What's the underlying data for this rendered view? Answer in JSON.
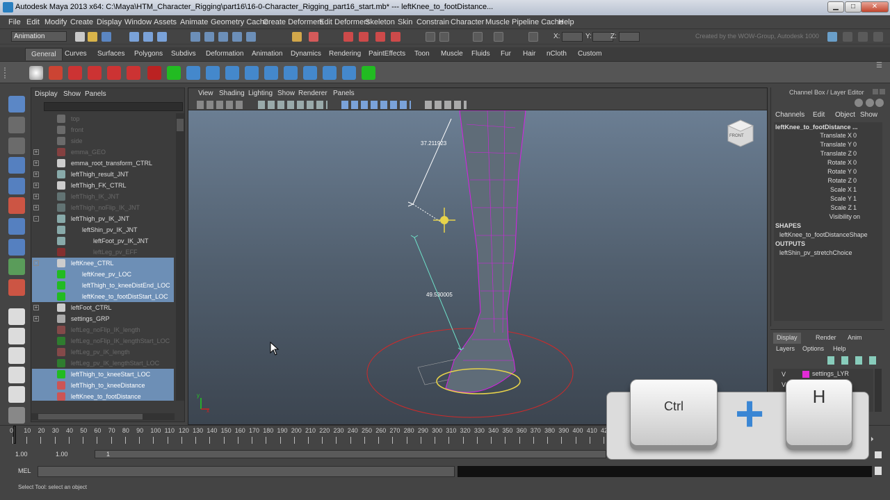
{
  "window": {
    "title": "Autodesk Maya 2013 x64: C:\\Maya\\HTM_Character_Rigging\\part16\\16-0-Character_Rigging_part16_start.mb*   ---   leftKnee_to_footDistance...",
    "min_label": "▁",
    "max_label": "□",
    "close_label": "✕"
  },
  "menubar": [
    "File",
    "Edit",
    "Modify",
    "Create",
    "Display",
    "Window",
    "Assets",
    "Animate",
    "Geometry Cache",
    "Create Deformers",
    "Edit Deformers",
    "Skeleton",
    "Skin",
    "Constrain",
    "Character",
    "Muscle",
    "Pipeline Cache",
    "Help"
  ],
  "status_line": {
    "mode": "Animation",
    "x_label": "X:",
    "y_label": "Y:",
    "z_label": "Z:",
    "credit": "Created by the WOW-Group, Autodesk 1000"
  },
  "shelf_tabs": [
    "General",
    "Curves",
    "Surfaces",
    "Polygons",
    "Subdivs",
    "Deformation",
    "Animation",
    "Dynamics",
    "Rendering",
    "PaintEffects",
    "Toon",
    "Muscle",
    "Fluids",
    "Fur",
    "Hair",
    "nCloth",
    "Custom"
  ],
  "shelf_active": "General",
  "outliner": {
    "menus": [
      "Display",
      "Show",
      "Panels"
    ],
    "rows": [
      {
        "label": "top",
        "icon": "camera-icon",
        "dim": true,
        "sel": false,
        "indent": 0,
        "expand": ""
      },
      {
        "label": "front",
        "icon": "camera-icon",
        "dim": true,
        "sel": false,
        "indent": 0,
        "expand": ""
      },
      {
        "label": "side",
        "icon": "camera-icon",
        "dim": true,
        "sel": false,
        "indent": 0,
        "expand": ""
      },
      {
        "label": "emma_GEO",
        "icon": "mesh-icon",
        "dim": true,
        "sel": false,
        "indent": 0,
        "expand": "+"
      },
      {
        "label": "emma_root_transform_CTRL",
        "icon": "curve-icon",
        "dim": false,
        "sel": false,
        "indent": 0,
        "expand": "+"
      },
      {
        "label": "leftThigh_result_JNT",
        "icon": "joint-icon",
        "dim": false,
        "sel": false,
        "indent": 0,
        "expand": "+"
      },
      {
        "label": "leftThigh_FK_CTRL",
        "icon": "curve-icon",
        "dim": false,
        "sel": false,
        "indent": 0,
        "expand": "+"
      },
      {
        "label": "leftThigh_IK_JNT",
        "icon": "joint-icon",
        "dim": true,
        "sel": false,
        "indent": 0,
        "expand": "+"
      },
      {
        "label": "leftThigh_noFlip_IK_JNT",
        "icon": "joint-icon",
        "dim": true,
        "sel": false,
        "indent": 0,
        "expand": "+"
      },
      {
        "label": "leftThigh_pv_IK_JNT",
        "icon": "joint-icon",
        "dim": false,
        "sel": false,
        "indent": 0,
        "expand": "-"
      },
      {
        "label": "leftShin_pv_IK_JNT",
        "icon": "joint-icon",
        "dim": false,
        "sel": false,
        "indent": 1,
        "expand": ""
      },
      {
        "label": "leftFoot_pv_IK_JNT",
        "icon": "joint-icon",
        "dim": false,
        "sel": false,
        "indent": 2,
        "expand": ""
      },
      {
        "label": "leftLeg_pv_EFF",
        "icon": "effector-icon",
        "dim": true,
        "sel": false,
        "indent": 2,
        "expand": ""
      },
      {
        "label": "leftKnee_CTRL",
        "icon": "curve-icon",
        "dim": false,
        "sel": true,
        "indent": 0,
        "expand": "-"
      },
      {
        "label": "leftKnee_pv_LOC",
        "icon": "locator-icon",
        "dim": false,
        "sel": true,
        "indent": 1,
        "expand": ""
      },
      {
        "label": "leftThigh_to_kneeDistEnd_LOC",
        "icon": "locator-icon",
        "dim": false,
        "sel": true,
        "indent": 1,
        "expand": ""
      },
      {
        "label": "leftKnee_to_footDistStart_LOC",
        "icon": "locator-icon",
        "dim": false,
        "sel": true,
        "indent": 1,
        "expand": ""
      },
      {
        "label": "leftFoot_CTRL",
        "icon": "curve-icon",
        "dim": false,
        "sel": false,
        "indent": 0,
        "expand": "+"
      },
      {
        "label": "settings_GRP",
        "icon": "group-icon",
        "dim": false,
        "sel": false,
        "indent": 0,
        "expand": "+"
      },
      {
        "label": "leftLeg_noFlip_IK_length",
        "icon": "distance-icon",
        "dim": true,
        "sel": false,
        "indent": 0,
        "expand": ""
      },
      {
        "label": "leftLeg_noFlip_IK_lengthStart_LOC",
        "icon": "locator-icon",
        "dim": true,
        "sel": false,
        "indent": 0,
        "expand": ""
      },
      {
        "label": "leftLeg_pv_IK_length",
        "icon": "distance-icon",
        "dim": true,
        "sel": false,
        "indent": 0,
        "expand": ""
      },
      {
        "label": "leftLeg_pv_IK_lengthStart_LOC",
        "icon": "locator-icon",
        "dim": true,
        "sel": false,
        "indent": 0,
        "expand": ""
      },
      {
        "label": "leftThigh_to_kneeStart_LOC",
        "icon": "locator-icon",
        "dim": false,
        "sel": true,
        "indent": 0,
        "expand": ""
      },
      {
        "label": "leftThigh_to_kneeDistance",
        "icon": "distance-icon",
        "dim": false,
        "sel": true,
        "indent": 0,
        "expand": ""
      },
      {
        "label": "leftKnee_to_footDistance",
        "icon": "distance-icon",
        "dim": false,
        "sel": true,
        "indent": 0,
        "expand": ""
      }
    ]
  },
  "viewport": {
    "menus": [
      "View",
      "Shading",
      "Lighting",
      "Show",
      "Renderer",
      "Panels"
    ],
    "distance_top": "37.211923",
    "distance_bottom": "49.530005",
    "view_cube_label": "FRONT",
    "axis_y": "y",
    "axis_x": "x"
  },
  "channel_box": {
    "title": "Channel Box / Layer Editor",
    "menus": [
      "Channels",
      "Edit",
      "Object",
      "Show"
    ],
    "node": "leftKnee_to_footDistance ...",
    "attrs": [
      {
        "name": "Translate X",
        "value": "0"
      },
      {
        "name": "Translate Y",
        "value": "0"
      },
      {
        "name": "Translate Z",
        "value": "0"
      },
      {
        "name": "Rotate X",
        "value": "0"
      },
      {
        "name": "Rotate Y",
        "value": "0"
      },
      {
        "name": "Rotate Z",
        "value": "0"
      },
      {
        "name": "Scale X",
        "value": "1"
      },
      {
        "name": "Scale Y",
        "value": "1"
      },
      {
        "name": "Scale Z",
        "value": "1"
      },
      {
        "name": "Visibility",
        "value": "on"
      }
    ],
    "shapes_header": "SHAPES",
    "shape": "leftKnee_to_footDistanceShape",
    "outputs_header": "OUTPUTS",
    "output": "leftShin_pv_stretchChoice"
  },
  "layer_editor": {
    "tabs": [
      "Display",
      "Render",
      "Anim"
    ],
    "menus": [
      "Layers",
      "Options",
      "Help"
    ],
    "layer_name": "settings_LYR",
    "vis": "V"
  },
  "timeline": {
    "ticks": [
      "0",
      "10",
      "20",
      "30",
      "40",
      "50",
      "60",
      "70",
      "80",
      "90",
      "100",
      "110",
      "120",
      "130",
      "140",
      "150",
      "160",
      "170",
      "180",
      "190",
      "200",
      "210",
      "220",
      "230",
      "240",
      "250",
      "260",
      "270",
      "280",
      "290",
      "300",
      "310",
      "320",
      "330",
      "340",
      "350",
      "360",
      "370",
      "380",
      "390",
      "400",
      "410",
      "420"
    ],
    "range_start": "1.00",
    "range_start2": "1.00",
    "range_marker": "1"
  },
  "mel": {
    "label": "MEL"
  },
  "help_line": "Select Tool: select an object",
  "keys": {
    "ctrl": "Ctrl",
    "plus": "+",
    "h": "H"
  },
  "colors": {
    "accent": "#5285c4",
    "selection": "#6d8fb6",
    "wire": "#e800ff",
    "locator": "#e8d34a"
  }
}
